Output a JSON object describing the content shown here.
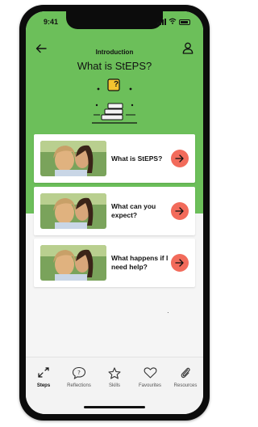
{
  "status": {
    "time": "9:41"
  },
  "header": {
    "title": "Introduction",
    "subtitle": "What is StEPS?"
  },
  "hero": {
    "badge": "?"
  },
  "cards": [
    {
      "label": "What is StEPS?"
    },
    {
      "label": "What can you expect?"
    },
    {
      "label": "What happens if I need help?"
    }
  ],
  "tabs": [
    {
      "label": "Steps",
      "icon": "steps-icon",
      "active": true
    },
    {
      "label": "Reflections",
      "icon": "reflections-icon",
      "active": false
    },
    {
      "label": "Skills",
      "icon": "star-icon",
      "active": false
    },
    {
      "label": "Favourites",
      "icon": "heart-icon",
      "active": false
    },
    {
      "label": "Resources",
      "icon": "paperclip-icon",
      "active": false
    }
  ],
  "colors": {
    "header_green": "#6cbf5a",
    "arrow_coral": "#f26b5b",
    "badge_yellow": "#f4c430"
  }
}
